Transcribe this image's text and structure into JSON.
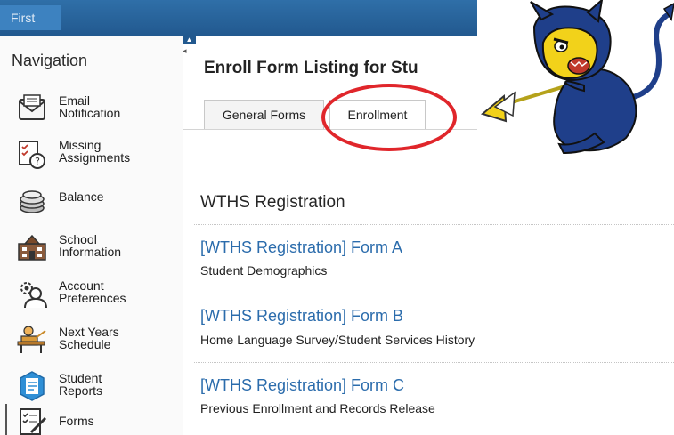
{
  "topbar": {
    "first_tab": "First"
  },
  "sidebar": {
    "title": "Navigation",
    "items": [
      {
        "line1": "Email",
        "line2": "Notification",
        "icon": "email-icon"
      },
      {
        "line1": "Missing",
        "line2": "Assignments",
        "icon": "missing-assignments-icon"
      },
      {
        "line1": "Balance",
        "line2": "",
        "icon": "coins-icon"
      },
      {
        "line1": "School",
        "line2": "Information",
        "icon": "school-icon"
      },
      {
        "line1": "Account",
        "line2": "Preferences",
        "icon": "gears-user-icon"
      },
      {
        "line1": "Next Years",
        "line2": "Schedule",
        "icon": "student-desk-icon"
      },
      {
        "line1": "Student",
        "line2": "Reports",
        "icon": "report-icon"
      },
      {
        "line1": "Forms",
        "line2": "",
        "icon": "forms-icon"
      }
    ]
  },
  "main": {
    "title": "Enroll Form Listing for Stu",
    "tabs": [
      {
        "label": "General Forms"
      },
      {
        "label": "Enrollment"
      }
    ],
    "section": "WTHS Registration",
    "forms": [
      {
        "link": "[WTHS Registration] Form A",
        "desc": "Student Demographics"
      },
      {
        "link": "[WTHS Registration] Form B",
        "desc": "Home Language Survey/Student Services History"
      },
      {
        "link": "[WTHS Registration] Form C",
        "desc": "Previous Enrollment and Records Release"
      }
    ]
  },
  "colors": {
    "topbar": "#22598f",
    "link": "#2b6cac",
    "highlight_circle": "#e0262b",
    "mascot_blue": "#1f3f8a",
    "mascot_yellow": "#f2d21a"
  }
}
